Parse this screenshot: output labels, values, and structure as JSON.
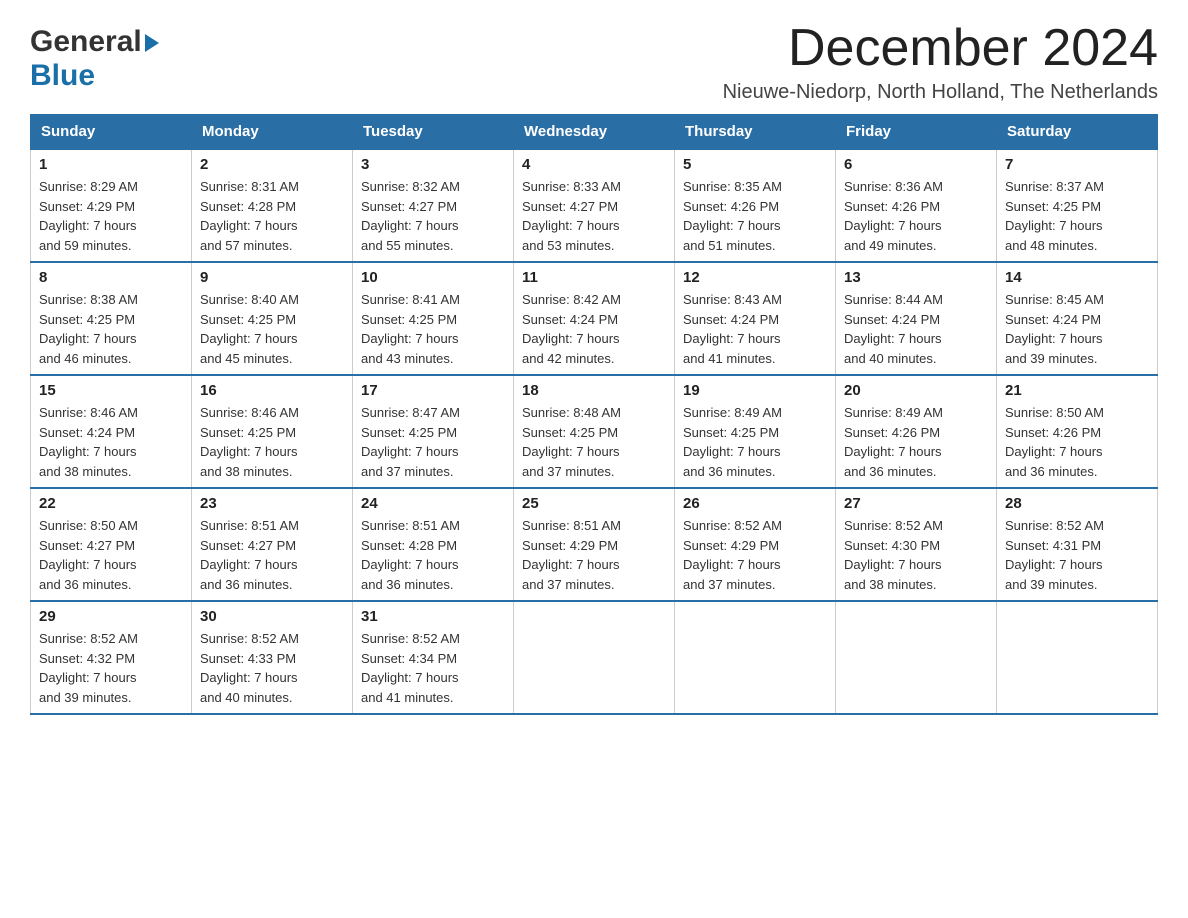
{
  "header": {
    "logo_general": "General",
    "logo_blue": "Blue",
    "title": "December 2024",
    "subtitle": "Nieuwe-Niedorp, North Holland, The Netherlands"
  },
  "calendar": {
    "days_of_week": [
      "Sunday",
      "Monday",
      "Tuesday",
      "Wednesday",
      "Thursday",
      "Friday",
      "Saturday"
    ],
    "weeks": [
      [
        {
          "day": "1",
          "sunrise": "Sunrise: 8:29 AM",
          "sunset": "Sunset: 4:29 PM",
          "daylight": "Daylight: 7 hours",
          "minutes": "and 59 minutes."
        },
        {
          "day": "2",
          "sunrise": "Sunrise: 8:31 AM",
          "sunset": "Sunset: 4:28 PM",
          "daylight": "Daylight: 7 hours",
          "minutes": "and 57 minutes."
        },
        {
          "day": "3",
          "sunrise": "Sunrise: 8:32 AM",
          "sunset": "Sunset: 4:27 PM",
          "daylight": "Daylight: 7 hours",
          "minutes": "and 55 minutes."
        },
        {
          "day": "4",
          "sunrise": "Sunrise: 8:33 AM",
          "sunset": "Sunset: 4:27 PM",
          "daylight": "Daylight: 7 hours",
          "minutes": "and 53 minutes."
        },
        {
          "day": "5",
          "sunrise": "Sunrise: 8:35 AM",
          "sunset": "Sunset: 4:26 PM",
          "daylight": "Daylight: 7 hours",
          "minutes": "and 51 minutes."
        },
        {
          "day": "6",
          "sunrise": "Sunrise: 8:36 AM",
          "sunset": "Sunset: 4:26 PM",
          "daylight": "Daylight: 7 hours",
          "minutes": "and 49 minutes."
        },
        {
          "day": "7",
          "sunrise": "Sunrise: 8:37 AM",
          "sunset": "Sunset: 4:25 PM",
          "daylight": "Daylight: 7 hours",
          "minutes": "and 48 minutes."
        }
      ],
      [
        {
          "day": "8",
          "sunrise": "Sunrise: 8:38 AM",
          "sunset": "Sunset: 4:25 PM",
          "daylight": "Daylight: 7 hours",
          "minutes": "and 46 minutes."
        },
        {
          "day": "9",
          "sunrise": "Sunrise: 8:40 AM",
          "sunset": "Sunset: 4:25 PM",
          "daylight": "Daylight: 7 hours",
          "minutes": "and 45 minutes."
        },
        {
          "day": "10",
          "sunrise": "Sunrise: 8:41 AM",
          "sunset": "Sunset: 4:25 PM",
          "daylight": "Daylight: 7 hours",
          "minutes": "and 43 minutes."
        },
        {
          "day": "11",
          "sunrise": "Sunrise: 8:42 AM",
          "sunset": "Sunset: 4:24 PM",
          "daylight": "Daylight: 7 hours",
          "minutes": "and 42 minutes."
        },
        {
          "day": "12",
          "sunrise": "Sunrise: 8:43 AM",
          "sunset": "Sunset: 4:24 PM",
          "daylight": "Daylight: 7 hours",
          "minutes": "and 41 minutes."
        },
        {
          "day": "13",
          "sunrise": "Sunrise: 8:44 AM",
          "sunset": "Sunset: 4:24 PM",
          "daylight": "Daylight: 7 hours",
          "minutes": "and 40 minutes."
        },
        {
          "day": "14",
          "sunrise": "Sunrise: 8:45 AM",
          "sunset": "Sunset: 4:24 PM",
          "daylight": "Daylight: 7 hours",
          "minutes": "and 39 minutes."
        }
      ],
      [
        {
          "day": "15",
          "sunrise": "Sunrise: 8:46 AM",
          "sunset": "Sunset: 4:24 PM",
          "daylight": "Daylight: 7 hours",
          "minutes": "and 38 minutes."
        },
        {
          "day": "16",
          "sunrise": "Sunrise: 8:46 AM",
          "sunset": "Sunset: 4:25 PM",
          "daylight": "Daylight: 7 hours",
          "minutes": "and 38 minutes."
        },
        {
          "day": "17",
          "sunrise": "Sunrise: 8:47 AM",
          "sunset": "Sunset: 4:25 PM",
          "daylight": "Daylight: 7 hours",
          "minutes": "and 37 minutes."
        },
        {
          "day": "18",
          "sunrise": "Sunrise: 8:48 AM",
          "sunset": "Sunset: 4:25 PM",
          "daylight": "Daylight: 7 hours",
          "minutes": "and 37 minutes."
        },
        {
          "day": "19",
          "sunrise": "Sunrise: 8:49 AM",
          "sunset": "Sunset: 4:25 PM",
          "daylight": "Daylight: 7 hours",
          "minutes": "and 36 minutes."
        },
        {
          "day": "20",
          "sunrise": "Sunrise: 8:49 AM",
          "sunset": "Sunset: 4:26 PM",
          "daylight": "Daylight: 7 hours",
          "minutes": "and 36 minutes."
        },
        {
          "day": "21",
          "sunrise": "Sunrise: 8:50 AM",
          "sunset": "Sunset: 4:26 PM",
          "daylight": "Daylight: 7 hours",
          "minutes": "and 36 minutes."
        }
      ],
      [
        {
          "day": "22",
          "sunrise": "Sunrise: 8:50 AM",
          "sunset": "Sunset: 4:27 PM",
          "daylight": "Daylight: 7 hours",
          "minutes": "and 36 minutes."
        },
        {
          "day": "23",
          "sunrise": "Sunrise: 8:51 AM",
          "sunset": "Sunset: 4:27 PM",
          "daylight": "Daylight: 7 hours",
          "minutes": "and 36 minutes."
        },
        {
          "day": "24",
          "sunrise": "Sunrise: 8:51 AM",
          "sunset": "Sunset: 4:28 PM",
          "daylight": "Daylight: 7 hours",
          "minutes": "and 36 minutes."
        },
        {
          "day": "25",
          "sunrise": "Sunrise: 8:51 AM",
          "sunset": "Sunset: 4:29 PM",
          "daylight": "Daylight: 7 hours",
          "minutes": "and 37 minutes."
        },
        {
          "day": "26",
          "sunrise": "Sunrise: 8:52 AM",
          "sunset": "Sunset: 4:29 PM",
          "daylight": "Daylight: 7 hours",
          "minutes": "and 37 minutes."
        },
        {
          "day": "27",
          "sunrise": "Sunrise: 8:52 AM",
          "sunset": "Sunset: 4:30 PM",
          "daylight": "Daylight: 7 hours",
          "minutes": "and 38 minutes."
        },
        {
          "day": "28",
          "sunrise": "Sunrise: 8:52 AM",
          "sunset": "Sunset: 4:31 PM",
          "daylight": "Daylight: 7 hours",
          "minutes": "and 39 minutes."
        }
      ],
      [
        {
          "day": "29",
          "sunrise": "Sunrise: 8:52 AM",
          "sunset": "Sunset: 4:32 PM",
          "daylight": "Daylight: 7 hours",
          "minutes": "and 39 minutes."
        },
        {
          "day": "30",
          "sunrise": "Sunrise: 8:52 AM",
          "sunset": "Sunset: 4:33 PM",
          "daylight": "Daylight: 7 hours",
          "minutes": "and 40 minutes."
        },
        {
          "day": "31",
          "sunrise": "Sunrise: 8:52 AM",
          "sunset": "Sunset: 4:34 PM",
          "daylight": "Daylight: 7 hours",
          "minutes": "and 41 minutes."
        },
        null,
        null,
        null,
        null
      ]
    ]
  }
}
